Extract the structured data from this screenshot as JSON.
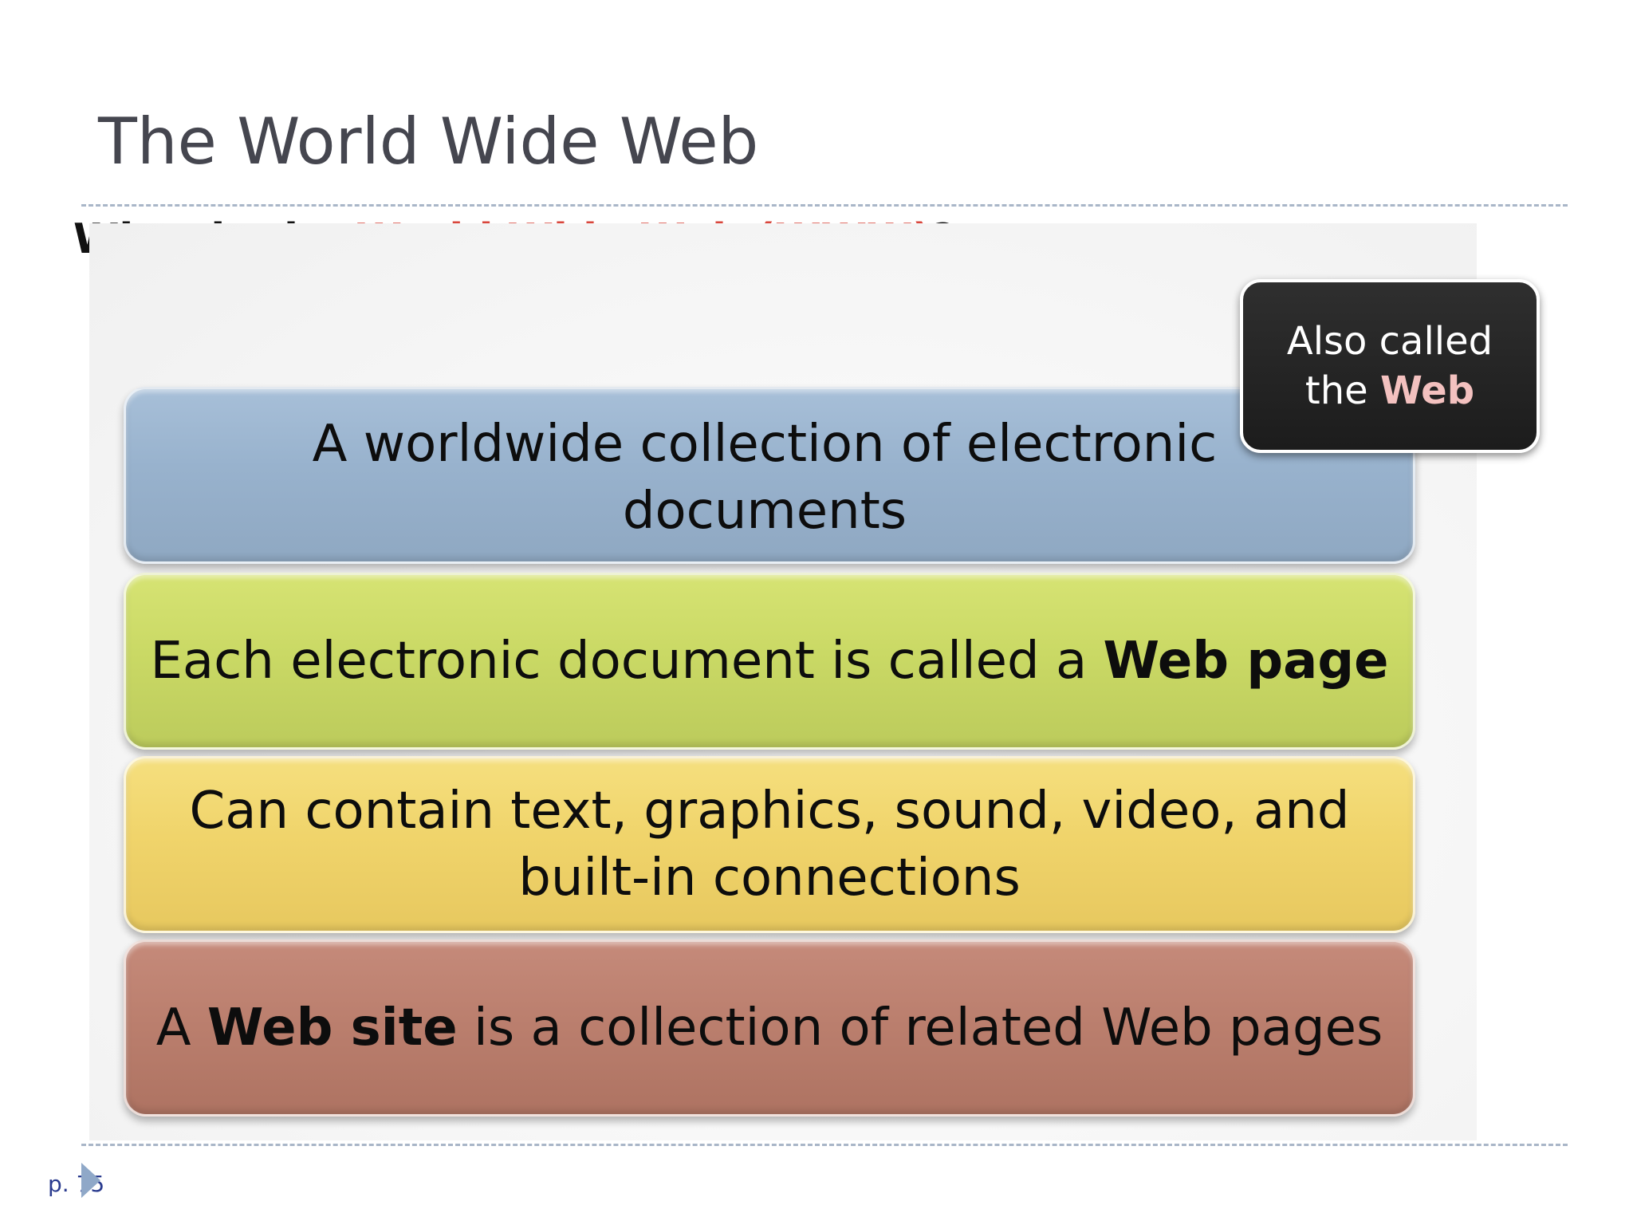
{
  "slide": {
    "title": "The World Wide Web",
    "question": {
      "prefix": "What is the ",
      "highlight": "World Wide Web (WWW)",
      "suffix": "?"
    },
    "bands": [
      {
        "line1": "A worldwide collection of electronic",
        "line2": "documents"
      },
      {
        "text": "Each electronic document is called a ",
        "bold": "Web page"
      },
      {
        "line1": "Can contain text, graphics, sound, video, and",
        "line2": "built-in connections"
      },
      {
        "prefix": "A ",
        "bold": "Web site",
        "suffix": " is a collection of related Web pages"
      }
    ],
    "callout": {
      "line1": "Also called",
      "line2_prefix": "the ",
      "line2_bold": "Web"
    },
    "page_number": "p. 75"
  },
  "colors": {
    "title": "#45464f",
    "highlight": "#d9453b",
    "band_blue": "#98b2cd",
    "band_green": "#cad965",
    "band_yellow": "#f0d46b",
    "band_brown": "#bb7f6e",
    "callout_bg": "#1c1c1c",
    "callout_accent": "#f3c1bf",
    "page_number": "#2a3b8f"
  }
}
